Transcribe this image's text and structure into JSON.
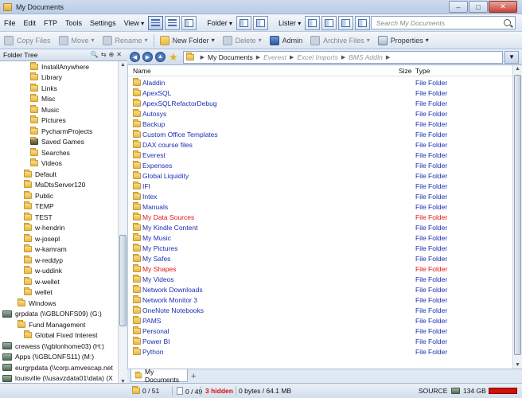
{
  "window": {
    "title": "My Documents"
  },
  "menu": [
    "File",
    "Edit",
    "FTP",
    "Tools",
    "Settings",
    "View",
    "Folder",
    "Lister"
  ],
  "search": {
    "placeholder": "Search My Documents"
  },
  "toolbar": {
    "copy_files": "Copy Files",
    "move": "Move",
    "rename": "Rename",
    "new_folder": "New Folder",
    "delete": "Delete",
    "admin": "Admin",
    "archive_files": "Archive Files",
    "properties": "Properties"
  },
  "tree": {
    "header": "Folder Tree",
    "items": [
      {
        "label": "InstallAnywhere",
        "indent": 3,
        "icon": "folder"
      },
      {
        "label": "Library",
        "indent": 3,
        "icon": "folder"
      },
      {
        "label": "Links",
        "indent": 3,
        "icon": "folder"
      },
      {
        "label": "Misc",
        "indent": 3,
        "icon": "folder"
      },
      {
        "label": "Music",
        "indent": 3,
        "icon": "folder"
      },
      {
        "label": "Pictures",
        "indent": 3,
        "icon": "folder"
      },
      {
        "label": "PycharmProjects",
        "indent": 3,
        "icon": "folder"
      },
      {
        "label": "Saved Games",
        "indent": 3,
        "icon": "special-folder"
      },
      {
        "label": "Searches",
        "indent": 3,
        "icon": "folder"
      },
      {
        "label": "Videos",
        "indent": 3,
        "icon": "folder"
      },
      {
        "label": "Default",
        "indent": 2,
        "icon": "folder"
      },
      {
        "label": "MsDtsServer120",
        "indent": 2,
        "icon": "folder"
      },
      {
        "label": "Public",
        "indent": 2,
        "icon": "folder"
      },
      {
        "label": "TEMP",
        "indent": 2,
        "icon": "folder"
      },
      {
        "label": "TEST",
        "indent": 2,
        "icon": "folder"
      },
      {
        "label": "w-hendrin",
        "indent": 2,
        "icon": "folder"
      },
      {
        "label": "w-josepl",
        "indent": 2,
        "icon": "folder"
      },
      {
        "label": "w-kamram",
        "indent": 2,
        "icon": "folder"
      },
      {
        "label": "w-reddyp",
        "indent": 2,
        "icon": "folder"
      },
      {
        "label": "w-uddink",
        "indent": 2,
        "icon": "folder"
      },
      {
        "label": "w-wellet",
        "indent": 2,
        "icon": "folder"
      },
      {
        "label": "wellet",
        "indent": 2,
        "icon": "folder"
      },
      {
        "label": "Windows",
        "indent": 1,
        "icon": "folder"
      },
      {
        "label": "grpdata (\\\\GBLONFS09) (G:)",
        "indent": 0,
        "icon": "drive"
      },
      {
        "label": "Fund Management",
        "indent": 1,
        "icon": "folder"
      },
      {
        "label": "Global Fixed Interest",
        "indent": 2,
        "icon": "folder"
      },
      {
        "label": "crewess (\\\\gblonhome03) (H:)",
        "indent": 0,
        "icon": "drive"
      },
      {
        "label": "Apps (\\\\GBLONFS11) (M:)",
        "indent": 0,
        "icon": "drive"
      },
      {
        "label": "eurgrpdata (\\\\corp.amvescap.net",
        "indent": 0,
        "icon": "drive"
      },
      {
        "label": "louisville (\\\\usavzdata01\\data) (X",
        "indent": 0,
        "icon": "drive"
      }
    ]
  },
  "address": {
    "crumbs": [
      "My Documents"
    ],
    "history_crumbs": [
      "Everest",
      "Excel Imports",
      "BMS AddIn"
    ]
  },
  "columns": {
    "name": "Name",
    "size": "Size",
    "type": "Type"
  },
  "files": [
    {
      "name": "Aladdin",
      "type": "File Folder",
      "color": "blue"
    },
    {
      "name": "ApexSQL",
      "type": "File Folder",
      "color": "blue"
    },
    {
      "name": "ApexSQLRefactorDebug",
      "type": "File Folder",
      "color": "blue"
    },
    {
      "name": "Autosys",
      "type": "File Folder",
      "color": "blue"
    },
    {
      "name": "Backup",
      "type": "File Folder",
      "color": "blue"
    },
    {
      "name": "Custom Office Templates",
      "type": "File Folder",
      "color": "blue"
    },
    {
      "name": "DAX course files",
      "type": "File Folder",
      "color": "blue"
    },
    {
      "name": "Everest",
      "type": "File Folder",
      "color": "blue"
    },
    {
      "name": "Expenses",
      "type": "File Folder",
      "color": "blue"
    },
    {
      "name": "Global Liquidity",
      "type": "File Folder",
      "color": "blue"
    },
    {
      "name": "IFI",
      "type": "File Folder",
      "color": "blue"
    },
    {
      "name": "Intex",
      "type": "File Folder",
      "color": "blue"
    },
    {
      "name": "Manuals",
      "type": "File Folder",
      "color": "blue"
    },
    {
      "name": "My Data Sources",
      "type": "File Folder",
      "color": "red"
    },
    {
      "name": "My Kindle Content",
      "type": "File Folder",
      "color": "blue"
    },
    {
      "name": "My Music",
      "type": "File Folder",
      "color": "blue"
    },
    {
      "name": "My Pictures",
      "type": "File Folder",
      "color": "blue"
    },
    {
      "name": "My Safes",
      "type": "File Folder",
      "color": "blue"
    },
    {
      "name": "My Shapes",
      "type": "File Folder",
      "color": "red"
    },
    {
      "name": "My Videos",
      "type": "File Folder",
      "color": "blue"
    },
    {
      "name": "Network Downloads",
      "type": "File Folder",
      "color": "blue"
    },
    {
      "name": "Network Monitor 3",
      "type": "File Folder",
      "color": "blue"
    },
    {
      "name": "OneNote Notebooks",
      "type": "File Folder",
      "color": "blue"
    },
    {
      "name": "PAMS",
      "type": "File Folder",
      "color": "blue"
    },
    {
      "name": "Personal",
      "type": "File Folder",
      "color": "blue"
    },
    {
      "name": "Power BI",
      "type": "File Folder",
      "color": "blue"
    },
    {
      "name": "Python",
      "type": "File Folder",
      "color": "blue"
    }
  ],
  "tabs": [
    {
      "label": "My Documents"
    }
  ],
  "status": {
    "folders": "0 / 51",
    "files": "0 / 49",
    "hidden": "3 hidden",
    "bytes": "0 bytes / 64.1 MB",
    "source": "SOURCE",
    "disk": "134 GB"
  },
  "colors": {
    "link_blue": "#1a2fb6",
    "system_red": "#e01515",
    "disk_bar": "#d40d0d"
  }
}
